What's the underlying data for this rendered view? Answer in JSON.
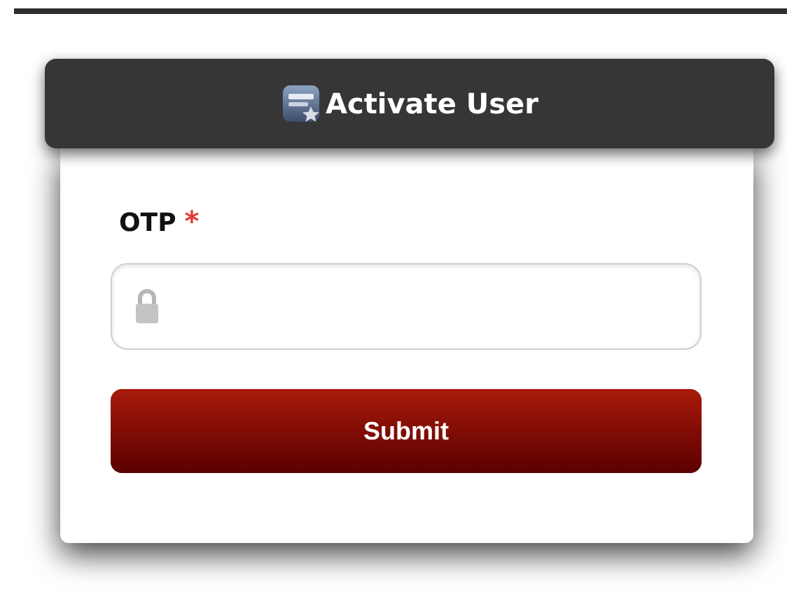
{
  "dialog": {
    "title": "Activate User"
  },
  "field": {
    "label": "OTP",
    "required_mark": "*"
  },
  "submit_button": {
    "label": "Submit"
  }
}
